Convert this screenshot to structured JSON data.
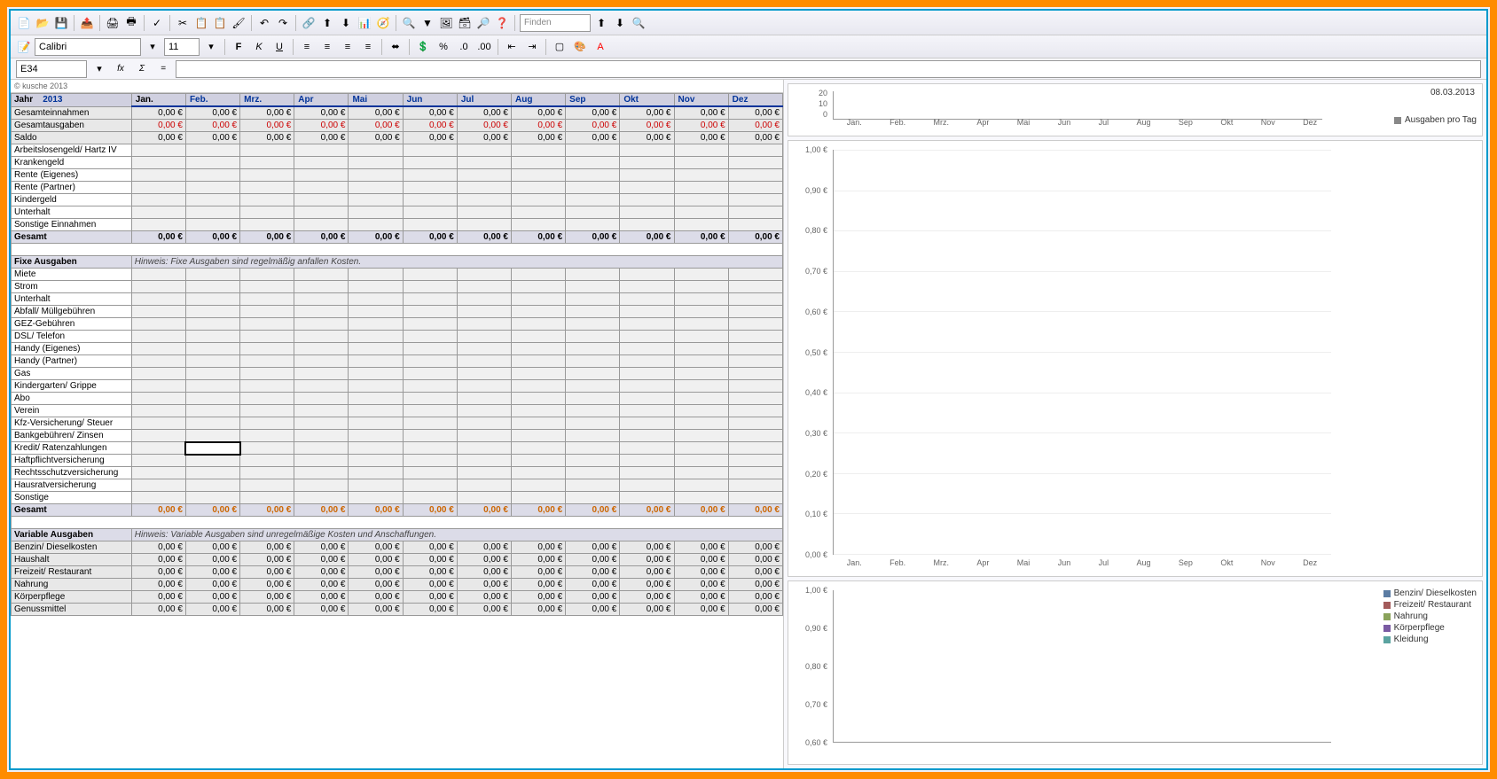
{
  "cell_ref": "E34",
  "font_name": "Calibri",
  "font_size": "11",
  "find_placeholder": "Finden",
  "copyright": "© kusche 2013",
  "chart_date": "08.03.2013",
  "year_label": "Jahr",
  "year_value": "2013",
  "months": [
    "Jan.",
    "Feb.",
    "Mrz.",
    "Apr",
    "Mai",
    "Jun",
    "Jul",
    "Aug",
    "Sep",
    "Okt",
    "Nov",
    "Dez"
  ],
  "zero": "0,00 €",
  "summary_rows": [
    {
      "label": "Gesamteinnahmen",
      "color": ""
    },
    {
      "label": "Gesamtausgaben",
      "color": "red"
    },
    {
      "label": "Saldo",
      "color": ""
    }
  ],
  "income_rows": [
    "Arbeitslosengeld/ Hartz IV",
    "Krankengeld",
    "Rente (Eigenes)",
    "Rente (Partner)",
    "Kindergeld",
    "Unterhalt",
    "Sonstige Einnahmen"
  ],
  "income_total": "Gesamt",
  "fixed_header": "Fixe Ausgaben",
  "fixed_hint": "Hinweis: Fixe Ausgaben sind regelmäßig anfallen Kosten.",
  "fixed_rows": [
    "Miete",
    "Strom",
    "Unterhalt",
    "Abfall/ Müllgebühren",
    "GEZ-Gebühren",
    "DSL/ Telefon",
    "Handy (Eigenes)",
    "Handy (Partner)",
    "Gas",
    "Kindergarten/ Grippe",
    "Abo",
    "Verein",
    "Kfz-Versicherung/ Steuer",
    "Bankgebühren/ Zinsen",
    "Kredit/ Ratenzahlungen",
    "Haftpflichtversicherung",
    "Rechtsschutzversicherung",
    "Hausratversicherung",
    "Sonstige"
  ],
  "fixed_total": "Gesamt",
  "var_header": "Variable Ausgaben",
  "var_hint": "Hinweis: Variable Ausgaben sind unregelmäßige Kosten und Anschaffungen.",
  "var_rows": [
    "Benzin/ Dieselkosten",
    "Haushalt",
    "Freizeit/ Restaurant",
    "Nahrung",
    "Körperpflege",
    "Genussmittel"
  ],
  "chart1_legend": "Ausgaben pro Tag",
  "chart1_yticks": [
    "20",
    "10",
    "0"
  ],
  "chart2_yticks": [
    "1,00 €",
    "0,90 €",
    "0,80 €",
    "0,70 €",
    "0,60 €",
    "0,50 €",
    "0,40 €",
    "0,30 €",
    "0,20 €",
    "0,10 €",
    "0,00 €"
  ],
  "chart3_yticks": [
    "1,00 €",
    "0,90 €",
    "0,80 €",
    "0,70 €",
    "0,60 €"
  ],
  "chart3_legend": [
    "Benzin/ Dieselkosten",
    "Freizeit/ Restaurant",
    "Nahrung",
    "Körperpflege",
    "Kleidung"
  ],
  "chart_data": [
    {
      "type": "bar",
      "title": "Ausgaben pro Tag",
      "categories": [
        "Jan.",
        "Feb.",
        "Mrz.",
        "Apr",
        "Mai",
        "Jun",
        "Jul",
        "Aug",
        "Sep",
        "Okt",
        "Nov",
        "Dez"
      ],
      "values": [
        0,
        0,
        0,
        0,
        0,
        0,
        0,
        0,
        0,
        0,
        0,
        0
      ],
      "ylim": [
        0,
        20
      ]
    },
    {
      "type": "line",
      "categories": [
        "Jan.",
        "Feb.",
        "Mrz.",
        "Apr",
        "Mai",
        "Jun",
        "Jul",
        "Aug",
        "Sep",
        "Okt",
        "Nov",
        "Dez"
      ],
      "values": [
        0,
        0,
        0,
        0,
        0,
        0,
        0,
        0,
        0,
        0,
        0,
        0
      ],
      "ylabel": "€",
      "ylim": [
        0,
        1.0
      ]
    },
    {
      "type": "line",
      "categories": [],
      "series": [
        {
          "name": "Benzin/ Dieselkosten",
          "values": []
        },
        {
          "name": "Freizeit/ Restaurant",
          "values": []
        },
        {
          "name": "Nahrung",
          "values": []
        },
        {
          "name": "Körperpflege",
          "values": []
        },
        {
          "name": "Kleidung",
          "values": []
        }
      ],
      "ylabel": "€",
      "ylim": [
        0.6,
        1.0
      ]
    }
  ]
}
